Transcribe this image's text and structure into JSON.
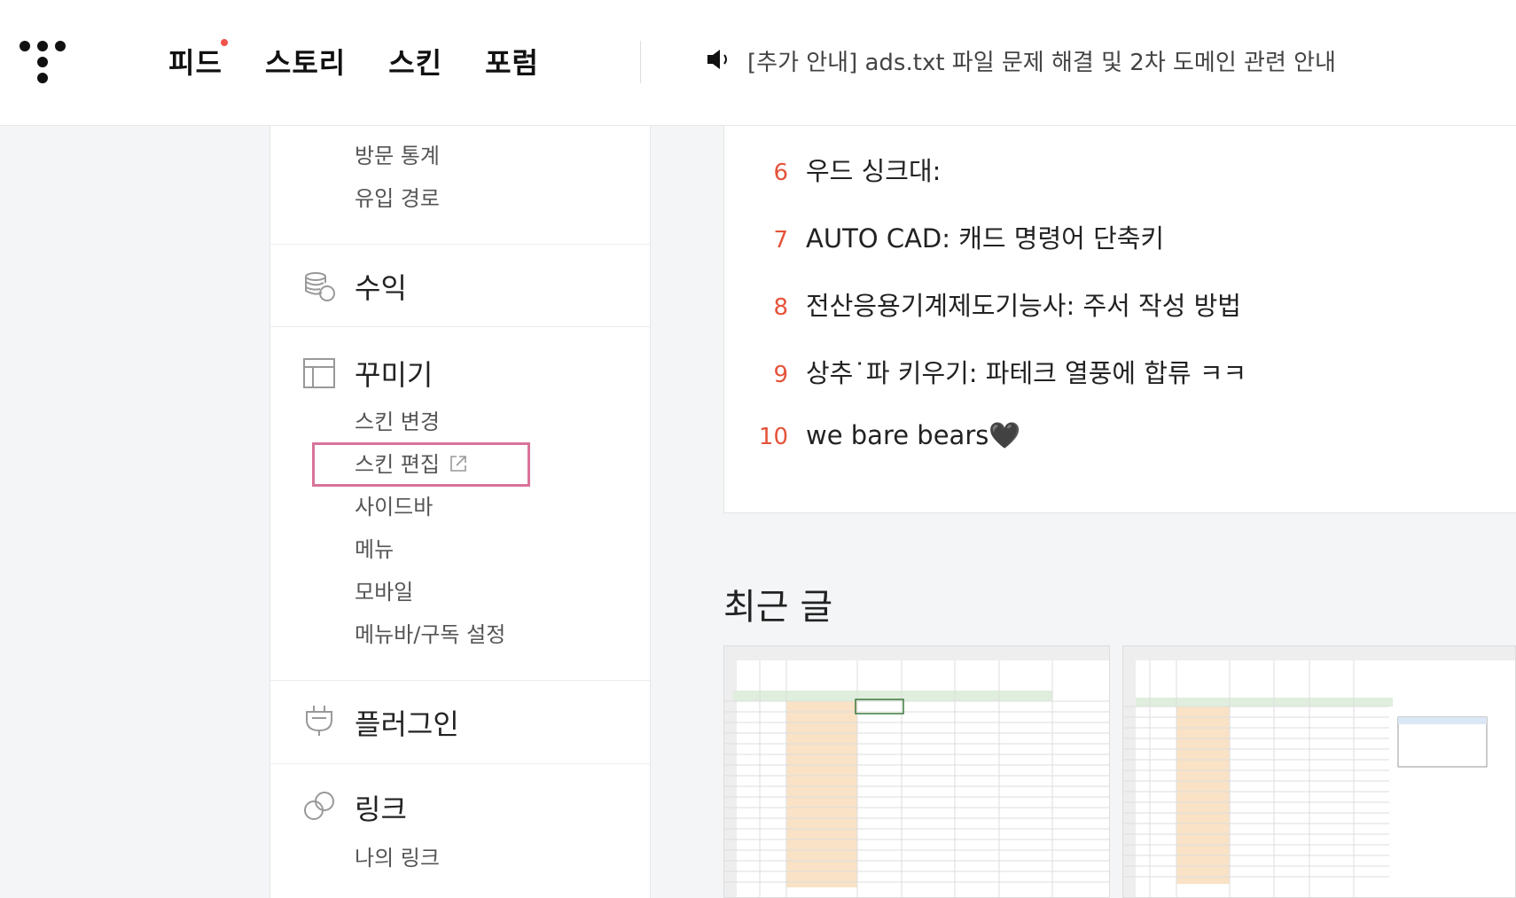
{
  "nav": {
    "items": [
      "피드",
      "스토리",
      "스킨",
      "포럼"
    ]
  },
  "notice": {
    "text": "[추가 안내] ads.txt 파일 문제 해결 및 2차 도메인 관련 안내"
  },
  "sidebar": {
    "stats_subitems": [
      "방문 통계",
      "유입 경로"
    ],
    "revenue": {
      "title": "수익"
    },
    "decorate": {
      "title": "꾸미기",
      "items": [
        "스킨 변경",
        "스킨 편집",
        "사이드바",
        "메뉴",
        "모바일",
        "메뉴바/구독 설정"
      ]
    },
    "plugin": {
      "title": "플러그인"
    },
    "link": {
      "title": "링크",
      "items": [
        "나의 링크"
      ]
    }
  },
  "popular_list": [
    {
      "num": "6",
      "text": "우드 싱크대:"
    },
    {
      "num": "7",
      "text": "AUTO CAD: 캐드 명령어 단축키"
    },
    {
      "num": "8",
      "text": "전산응용기계제도기능사: 주서 작성 방법"
    },
    {
      "num": "9",
      "text": "상추˙파 키우기: 파테크 열풍에 합류 ㅋㅋ"
    },
    {
      "num": "10",
      "text": "we bare bears🖤"
    }
  ],
  "recent": {
    "title": "최근 글"
  },
  "colors": {
    "accent_red": "#e5533a",
    "highlight_pink": "#d9739a",
    "notification_dot": "#f0524b"
  }
}
